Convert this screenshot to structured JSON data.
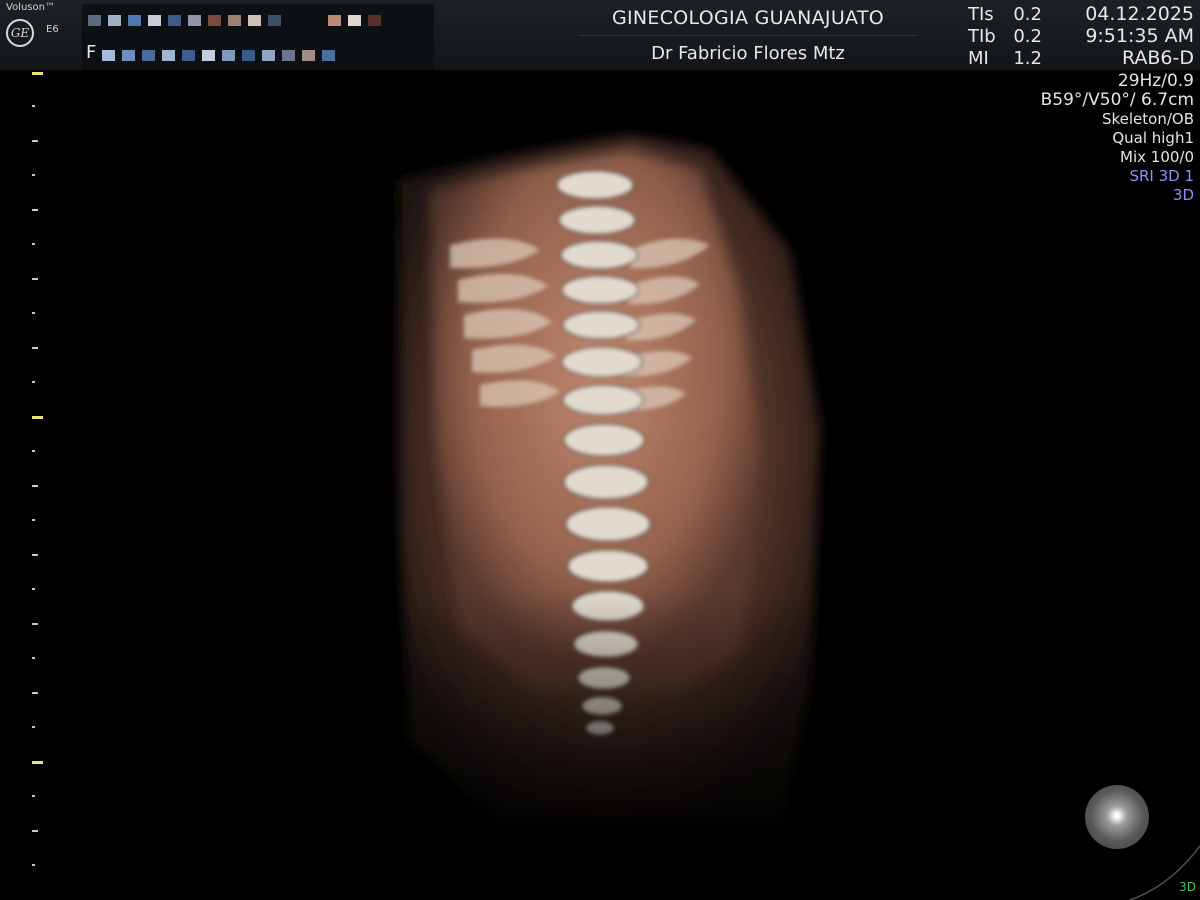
{
  "brand": {
    "name": "Voluson™",
    "model": "E6",
    "logo": "GE"
  },
  "patient": {
    "id_visible_char": "F",
    "note": ""
  },
  "header": {
    "clinic": "GINECOLOGIA GUANAJUATO",
    "doctor": "Dr Fabricio Flores Mtz"
  },
  "params": [
    {
      "label": "TIs",
      "value": "0.2"
    },
    {
      "label": "TIb",
      "value": "0.2"
    },
    {
      "label": "MI",
      "value": "1.2"
    }
  ],
  "datetime": {
    "date": "04.12.2025",
    "time": "9:51:35 AM",
    "probe": "RAB6-D"
  },
  "acquisition": {
    "frame_rate": "29Hz/0.9",
    "volume": "B59°/V50°/ 6.7cm",
    "preset": "Skeleton/OB",
    "quality": "Qual high1",
    "mix": "Mix 100/0",
    "sri": "SRI 3D 1",
    "mode": "3D"
  },
  "view": {
    "mode_indicator": "3D"
  },
  "colors": {
    "accent_blue": "#8f8cff",
    "mode_green": "#47c447",
    "scale_accent": "#e8e27a",
    "tissue": "#c48870",
    "bone": "#d9d2c4"
  }
}
